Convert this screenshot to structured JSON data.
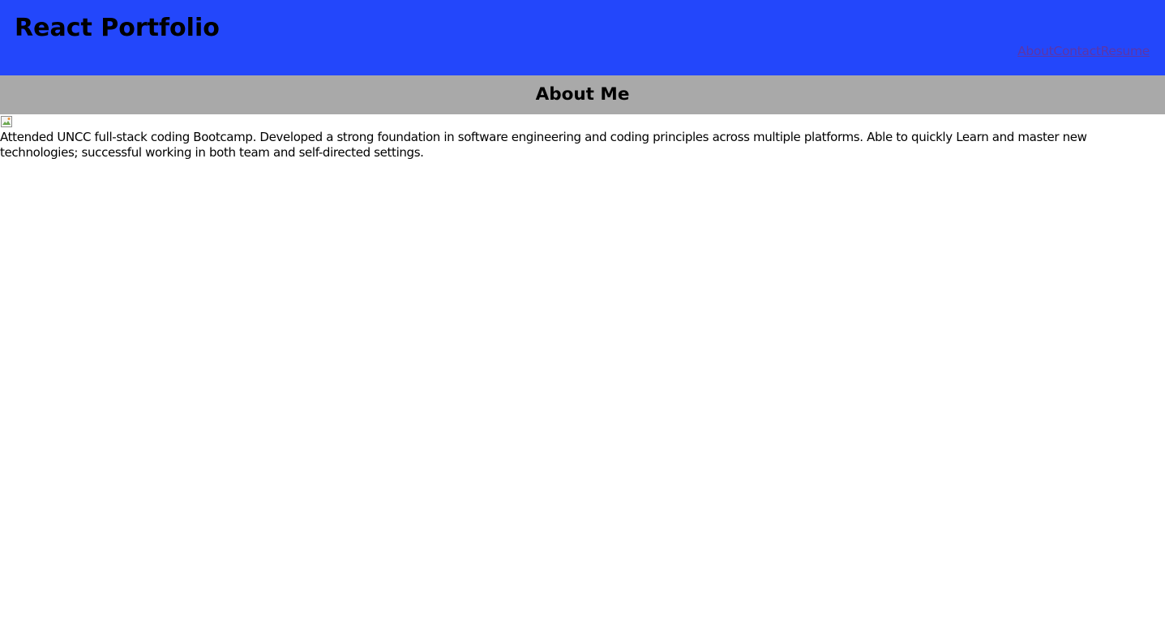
{
  "header": {
    "title": "React Portfolio",
    "background_color": "#2347fb",
    "nav": [
      {
        "label": "About"
      },
      {
        "label": "Contact"
      },
      {
        "label": "Resume"
      }
    ]
  },
  "about": {
    "heading": "About Me",
    "bar_color": "#a9a9a9",
    "image_icon": "broken-image-icon",
    "bio": "Attended UNCC full-stack coding Bootcamp. Developed a strong foundation in software engineering and coding principles across multiple platforms. Able to quickly Learn and master new technologies; successful working in both team and self-directed settings."
  },
  "colors": {
    "link": "#5c36a8",
    "text": "#000000"
  }
}
